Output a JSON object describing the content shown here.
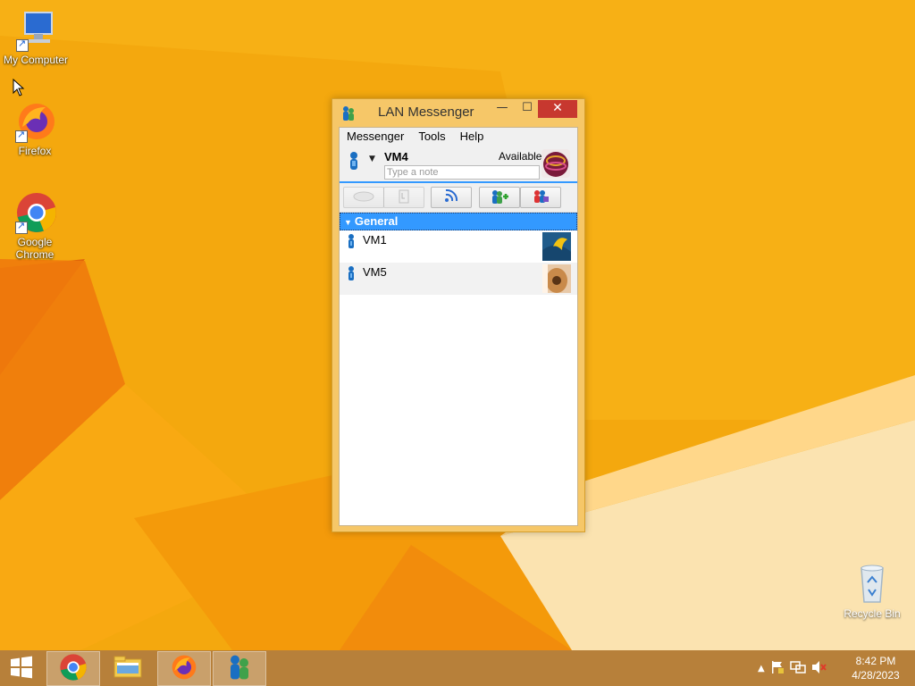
{
  "desktop": {
    "icons": [
      {
        "label": "My Computer",
        "icon": "computer-icon"
      },
      {
        "label": "Firefox",
        "icon": "firefox-icon"
      },
      {
        "label": "Google Chrome",
        "icon": "chrome-icon"
      }
    ],
    "recycle_bin": {
      "label": "Recycle Bin",
      "icon": "recycle-bin-icon"
    }
  },
  "window": {
    "title": "LAN Messenger",
    "controls": {
      "minimize": "—",
      "maximize": "☐",
      "close": "✕"
    },
    "menu": [
      "Messenger",
      "Tools",
      "Help"
    ],
    "user": {
      "name": "VM4",
      "status": "Available",
      "note_placeholder": "Type a note"
    },
    "toolbar": [
      {
        "icon": "chat-icon",
        "enabled": false
      },
      {
        "icon": "send-file-icon",
        "enabled": false
      },
      {
        "icon": "broadcast-icon",
        "enabled": true
      },
      {
        "icon": "add-contact-icon",
        "enabled": true
      },
      {
        "icon": "public-chat-icon",
        "enabled": true
      }
    ],
    "group": {
      "name": "General"
    },
    "contacts": [
      {
        "name": "VM1"
      },
      {
        "name": "VM5"
      }
    ]
  },
  "taskbar": {
    "items": [
      {
        "icon": "chrome-icon",
        "active": true
      },
      {
        "icon": "file-explorer-icon",
        "active": false
      },
      {
        "icon": "firefox-icon",
        "active": true
      },
      {
        "icon": "lan-messenger-icon",
        "active": true
      }
    ],
    "clock": {
      "time": "8:42 PM",
      "date": "4/28/2023"
    }
  },
  "colors": {
    "wallpaper": "#f4a80e",
    "taskbar": "#b7803a",
    "accent": "#3399ff",
    "close": "#c7382f"
  }
}
